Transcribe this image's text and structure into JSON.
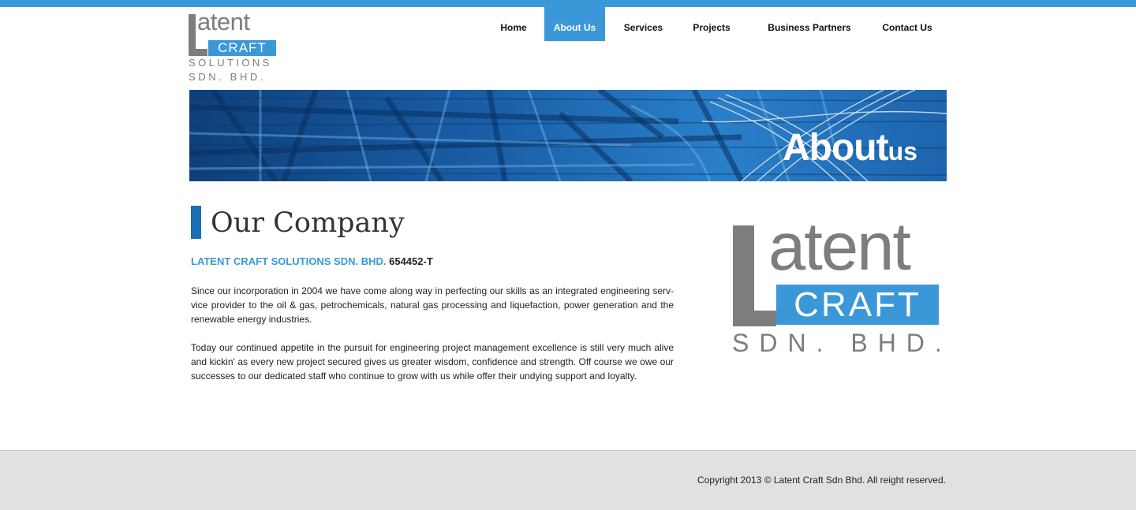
{
  "logo": {
    "line1": "atent",
    "line2": "CRAFT",
    "line3": "SOLUTIONS",
    "line4": "SDN. BHD."
  },
  "nav": {
    "items": [
      {
        "label": "Home"
      },
      {
        "label": "About Us"
      },
      {
        "label": "Services"
      },
      {
        "label": "Projects"
      },
      {
        "label": "Business Partners"
      },
      {
        "label": "Contact Us"
      }
    ],
    "active": "About Us"
  },
  "banner": {
    "title_main": "About",
    "title_sub": "us"
  },
  "main": {
    "heading": "Our Company",
    "company_name": "LATENT CRAFT SOLUTIONS SDN. BHD.",
    "company_reg": "654452-T",
    "paragraphs": [
      "Since our incorporation in 2004 we have come along way in perfecting our skills as an integrated engineering serv-vice provider to the oil & gas, petrochemicals, natural gas processing and liquefaction, power generation  and the renewable energy industries.",
      "Today our continued appetite in the pursuit for engineering project management excellence is still very much alive and kickin' as every new project secured gives us greater wisdom, confidence and strength.  Off course we owe our successes to our dedicated staff who continue to grow with us while offer their undying support and loyalty."
    ]
  },
  "side_logo": {
    "line1": "atent",
    "line2": "CRAFT",
    "line3": "SDN. BHD."
  },
  "footer": {
    "copyright": "Copyright 2013 © Latent Craft Sdn Bhd. All reight reserved."
  },
  "colors": {
    "accent": "#3a98d8",
    "accent_dark": "#1a6fb5",
    "logo_gray": "#7d7d7f",
    "footer_bg": "#e1e1e1"
  }
}
